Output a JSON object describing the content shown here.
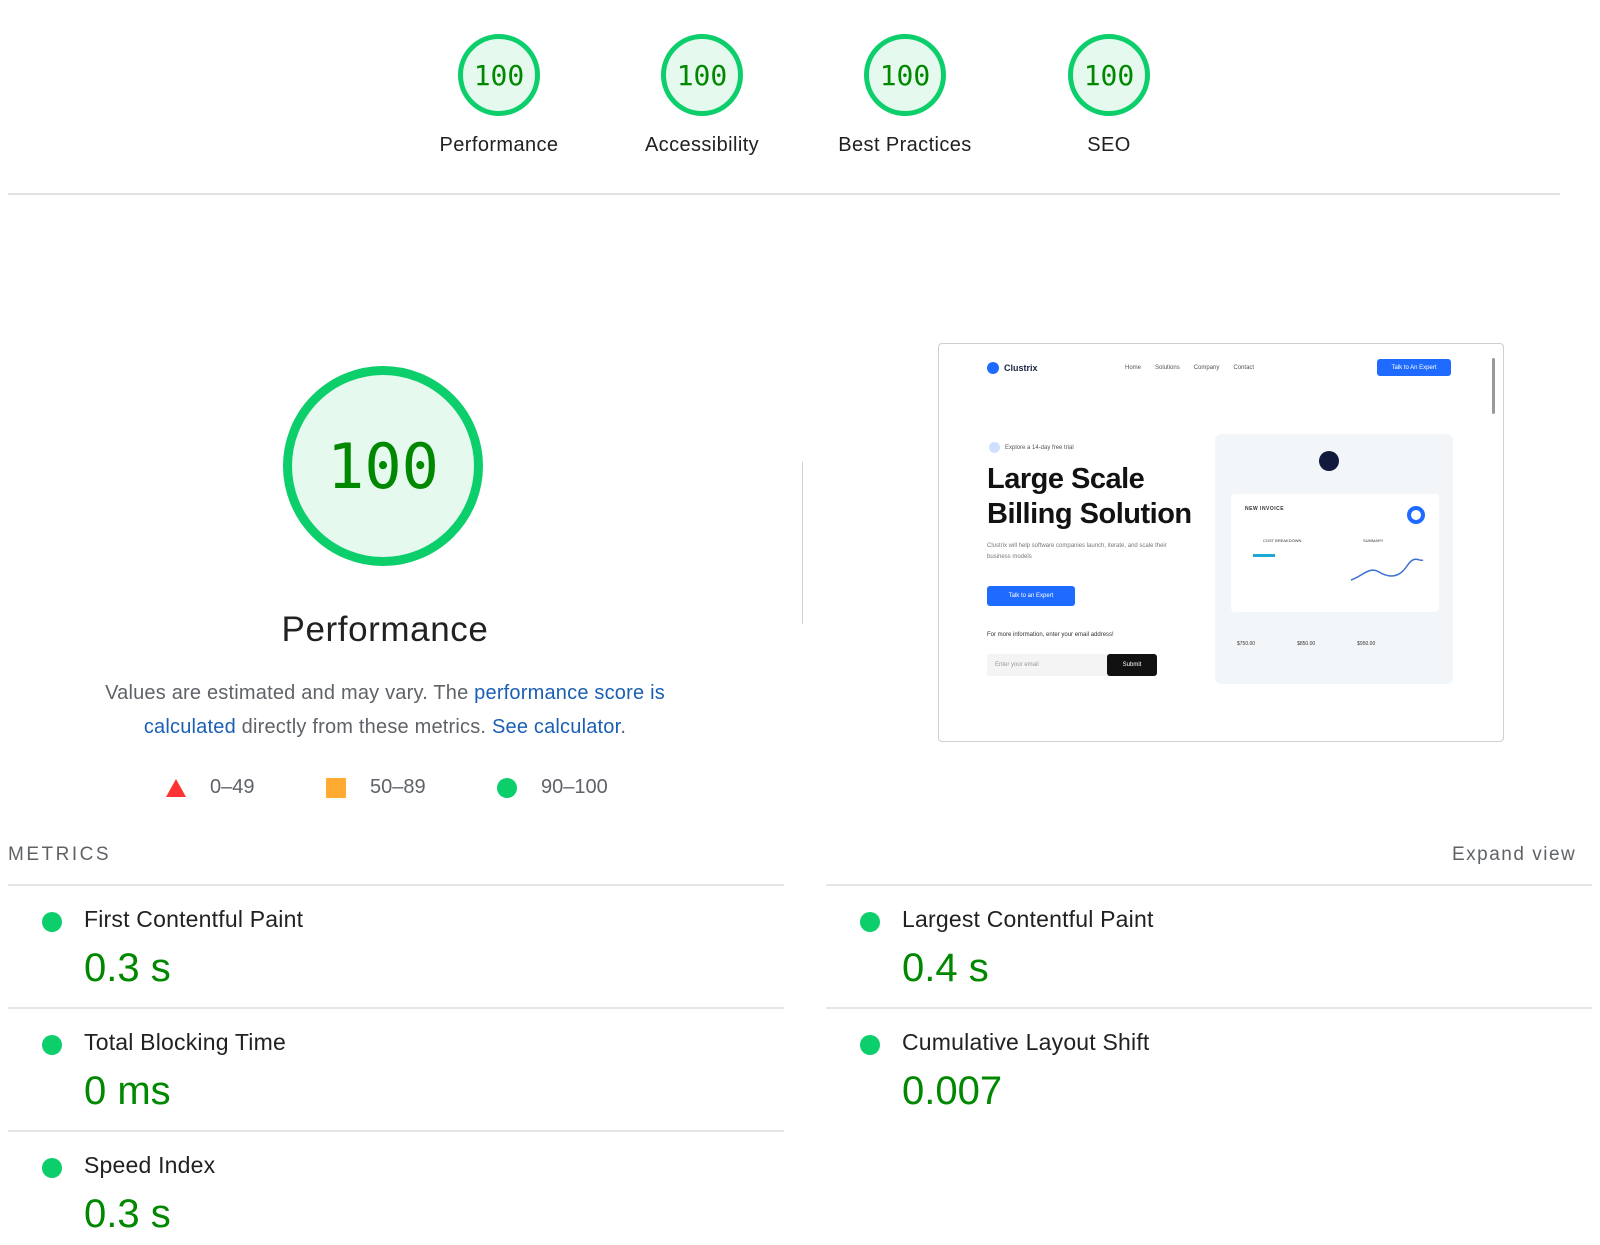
{
  "scores": [
    {
      "value": "100",
      "label": "Performance"
    },
    {
      "value": "100",
      "label": "Accessibility"
    },
    {
      "value": "100",
      "label": "Best Practices"
    },
    {
      "value": "100",
      "label": "SEO"
    }
  ],
  "main": {
    "score": "100",
    "title": "Performance",
    "desc_pre": "Values are estimated and may vary. The ",
    "desc_link1": "performance score is calculated",
    "desc_mid": " directly from these metrics. ",
    "desc_link2": "See calculator",
    "desc_end": "."
  },
  "legend": [
    {
      "range": "0–49",
      "color": "#ff3333",
      "shape": "triangle"
    },
    {
      "range": "50–89",
      "color": "#ffaa33",
      "shape": "square"
    },
    {
      "range": "90–100",
      "color": "#0cce6b",
      "shape": "circle"
    }
  ],
  "thumbnail": {
    "brand": "Clustrix",
    "nav": [
      "Home",
      "Solutions",
      "Company",
      "Contact"
    ],
    "header_button": "Talk to An Expert",
    "trial": "Explore a 14-day free trial",
    "headline": "Large Scale Billing Solution",
    "sub": "Clustrix will help software companies launch, iterate, and scale their business models",
    "cta": "Talk to an Expert",
    "info": "For more information, enter your email address!",
    "email_placeholder": "Enter your email",
    "submit": "Submit",
    "invoice_title": "NEW INVOICE",
    "cost_breakdown": "COST BREAKDOWN",
    "summary": "SUMMARY",
    "amounts": [
      "$750.00",
      "$850.00",
      "$950.00"
    ]
  },
  "metrics": {
    "heading": "METRICS",
    "expand": "Expand view",
    "fcp": {
      "name": "First Contentful Paint",
      "value": "0.3 s"
    },
    "lcp": {
      "name": "Largest Contentful Paint",
      "value": "0.4 s"
    },
    "tbt": {
      "name": "Total Blocking Time",
      "value": "0 ms"
    },
    "cls": {
      "name": "Cumulative Layout Shift",
      "value": "0.007"
    },
    "si": {
      "name": "Speed Index",
      "value": "0.3 s"
    }
  },
  "colors": {
    "pass": "#0cce6b",
    "pass_text": "#008800",
    "link": "#1a5fb4"
  }
}
